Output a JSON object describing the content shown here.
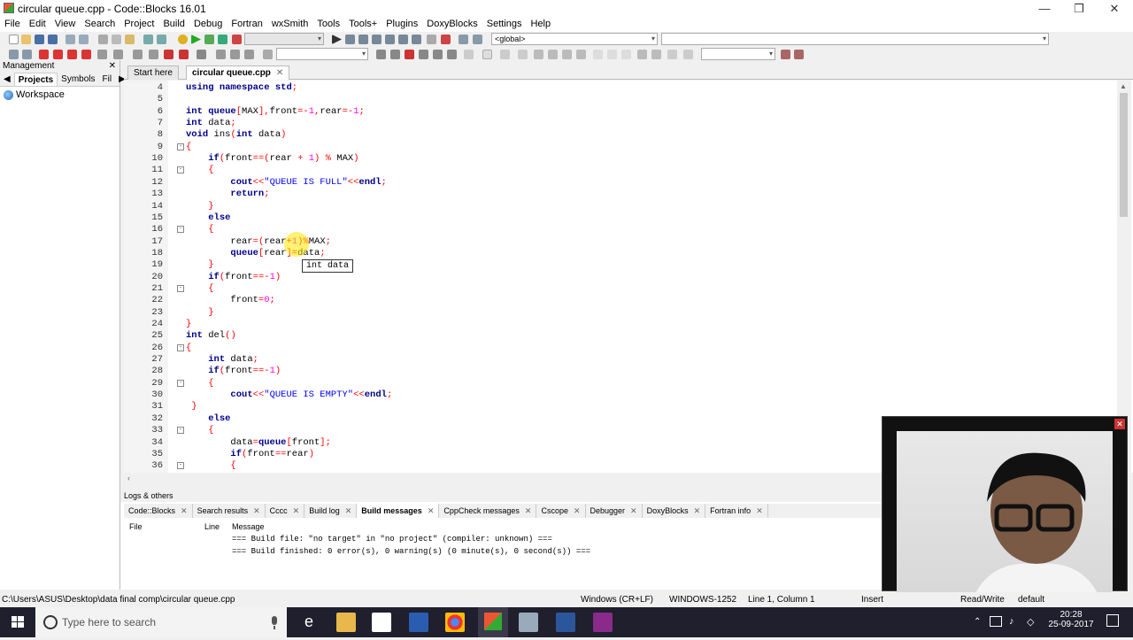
{
  "window": {
    "title": "circular queue.cpp - Code::Blocks 16.01"
  },
  "menu": [
    "File",
    "Edit",
    "View",
    "Search",
    "Project",
    "Build",
    "Debug",
    "Fortran",
    "wxSmith",
    "Tools",
    "Tools+",
    "Plugins",
    "DoxyBlocks",
    "Settings",
    "Help"
  ],
  "toolbar": {
    "scope_combo": "<global>"
  },
  "management": {
    "title": "Management",
    "tabs": [
      "Projects",
      "Symbols",
      "Fil"
    ],
    "workspace": "Workspace"
  },
  "editor_tabs": [
    "Start here",
    "circular queue.cpp"
  ],
  "code_lines": [
    {
      "n": "4",
      "fold": "",
      "t": "using namespace std;"
    },
    {
      "n": "5",
      "fold": "",
      "t": ""
    },
    {
      "n": "6",
      "fold": "",
      "t": "int queue[MAX],front=-1,rear=-1;"
    },
    {
      "n": "7",
      "fold": "",
      "t": "int data;"
    },
    {
      "n": "8",
      "fold": "",
      "t": "void ins(int data)"
    },
    {
      "n": "9",
      "fold": "-",
      "t": "{"
    },
    {
      "n": "10",
      "fold": "",
      "t": "    if(front==(rear + 1) % MAX)"
    },
    {
      "n": "11",
      "fold": "-",
      "t": "    {"
    },
    {
      "n": "12",
      "fold": "",
      "t": "        cout<<\"QUEUE IS FULL\"<<endl;"
    },
    {
      "n": "13",
      "fold": "",
      "t": "        return;"
    },
    {
      "n": "14",
      "fold": "",
      "t": "    }"
    },
    {
      "n": "15",
      "fold": "",
      "t": "    else"
    },
    {
      "n": "16",
      "fold": "-",
      "t": "    {"
    },
    {
      "n": "17",
      "fold": "",
      "t": "        rear=(rear+1)%MAX;"
    },
    {
      "n": "18",
      "fold": "",
      "t": "        queue[rear]=data;"
    },
    {
      "n": "19",
      "fold": "",
      "t": "    }"
    },
    {
      "n": "20",
      "fold": "",
      "t": "    if(front==-1)"
    },
    {
      "n": "21",
      "fold": "-",
      "t": "    {"
    },
    {
      "n": "22",
      "fold": "",
      "t": "        front=0;"
    },
    {
      "n": "23",
      "fold": "",
      "t": "    }"
    },
    {
      "n": "24",
      "fold": "",
      "t": "}"
    },
    {
      "n": "25",
      "fold": "",
      "t": "int del()"
    },
    {
      "n": "26",
      "fold": "-",
      "t": "{"
    },
    {
      "n": "27",
      "fold": "",
      "t": "    int data;"
    },
    {
      "n": "28",
      "fold": "",
      "t": "    if(front==-1)"
    },
    {
      "n": "29",
      "fold": "-",
      "t": "    {"
    },
    {
      "n": "30",
      "fold": "",
      "t": "        cout<<\"QUEUE IS EMPTY\"<<endl;"
    },
    {
      "n": "31",
      "fold": "",
      "t": " }"
    },
    {
      "n": "32",
      "fold": "",
      "t": "    else"
    },
    {
      "n": "33",
      "fold": "-",
      "t": "    {"
    },
    {
      "n": "34",
      "fold": "",
      "t": "        data=queue[front];"
    },
    {
      "n": "35",
      "fold": "",
      "t": "        if(front==rear)"
    },
    {
      "n": "36",
      "fold": "-",
      "t": "        {"
    }
  ],
  "tooltip": "int data",
  "logs": {
    "title": "Logs & others",
    "tabs": [
      "Code::Blocks",
      "Search results",
      "Cccc",
      "Build log",
      "Build messages",
      "CppCheck messages",
      "Cscope",
      "Debugger",
      "DoxyBlocks",
      "Fortran info"
    ],
    "active_tab": "Build messages",
    "columns": [
      "File",
      "Line",
      "Message"
    ],
    "rows": [
      "=== Build file: \"no target\" in \"no project\" (compiler: unknown) ===",
      "=== Build finished: 0 error(s), 0 warning(s) (0 minute(s), 0 second(s)) ==="
    ]
  },
  "status": {
    "path": "C:\\Users\\ASUS\\Desktop\\data final comp\\circular queue.cpp",
    "eol": "Windows (CR+LF)",
    "encoding": "WINDOWS-1252",
    "position": "Line 1, Column 1",
    "mode": "Insert",
    "access": "Read/Write",
    "profile": "default"
  },
  "taskbar": {
    "search_placeholder": "Type here to search",
    "time": "20:28",
    "date": "25-09-2017"
  }
}
